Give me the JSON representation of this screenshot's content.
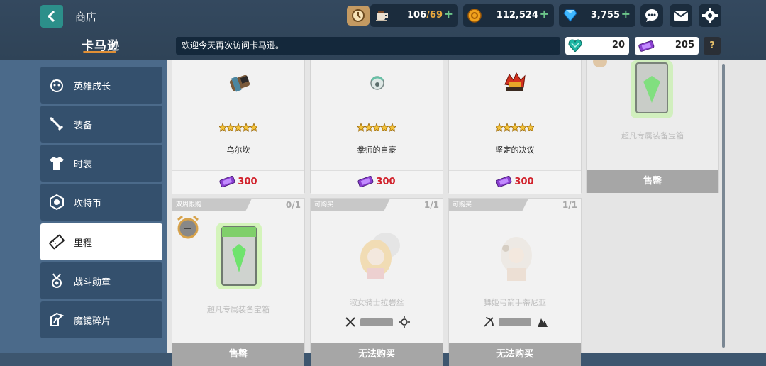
{
  "header": {
    "title": "商店",
    "brand": "卡马逊",
    "marquee": "欢迎今天再次访问卡马逊。"
  },
  "resources": {
    "stamina": {
      "current": "106",
      "max": "/69",
      "icon": "coffee-cup-icon"
    },
    "gold": {
      "value": "112,524",
      "icon": "gold-coin-icon"
    },
    "gems": {
      "value": "3,755",
      "icon": "diamond-icon"
    },
    "plus": "+"
  },
  "currencies": {
    "green_gem": {
      "value": "20",
      "icon": "green-heart-gem-icon"
    },
    "ticket": {
      "value": "205",
      "icon": "purple-ticket-icon"
    },
    "help": "?"
  },
  "sidebar": {
    "items": [
      {
        "label": "英雄成长",
        "icon": "hero-growth-icon",
        "active": false
      },
      {
        "label": "装备",
        "icon": "equipment-icon",
        "active": false
      },
      {
        "label": "时装",
        "icon": "costume-icon",
        "active": false
      },
      {
        "label": "坎特币",
        "icon": "kanterra-coin-icon",
        "active": false
      },
      {
        "label": "里程",
        "icon": "mileage-ticket-icon",
        "active": true
      },
      {
        "label": "战斗勋章",
        "icon": "medal-icon",
        "active": false
      },
      {
        "label": "魔镜碎片",
        "icon": "mirror-shard-icon",
        "active": false
      }
    ]
  },
  "shop": {
    "row1": [
      {
        "name": "乌尔坎",
        "price": "300",
        "rating_stars": 5
      },
      {
        "name": "拳师的自豪",
        "price": "300",
        "rating_stars": 5
      },
      {
        "name": "坚定的决议",
        "price": "300",
        "rating_stars": 5
      },
      {
        "name": "超凡专属装备宝箱",
        "status": "售罄"
      }
    ],
    "row2": [
      {
        "tag": "双周限购",
        "limit": "0/1",
        "name": "超凡专属装备宝箱",
        "status": "售罄"
      },
      {
        "tag": "可购买",
        "limit": "1/1",
        "name": "淑女骑士拉碧丝",
        "status": "无法购买"
      },
      {
        "tag": "可购买",
        "limit": "1/1",
        "name": "舞姬弓箭手蒂尼亚",
        "status": "无法购买"
      }
    ]
  },
  "colors": {
    "accent": "#2c8f8a",
    "price_red": "#d1202a",
    "sidebar_bg": "#4b6a8a"
  }
}
